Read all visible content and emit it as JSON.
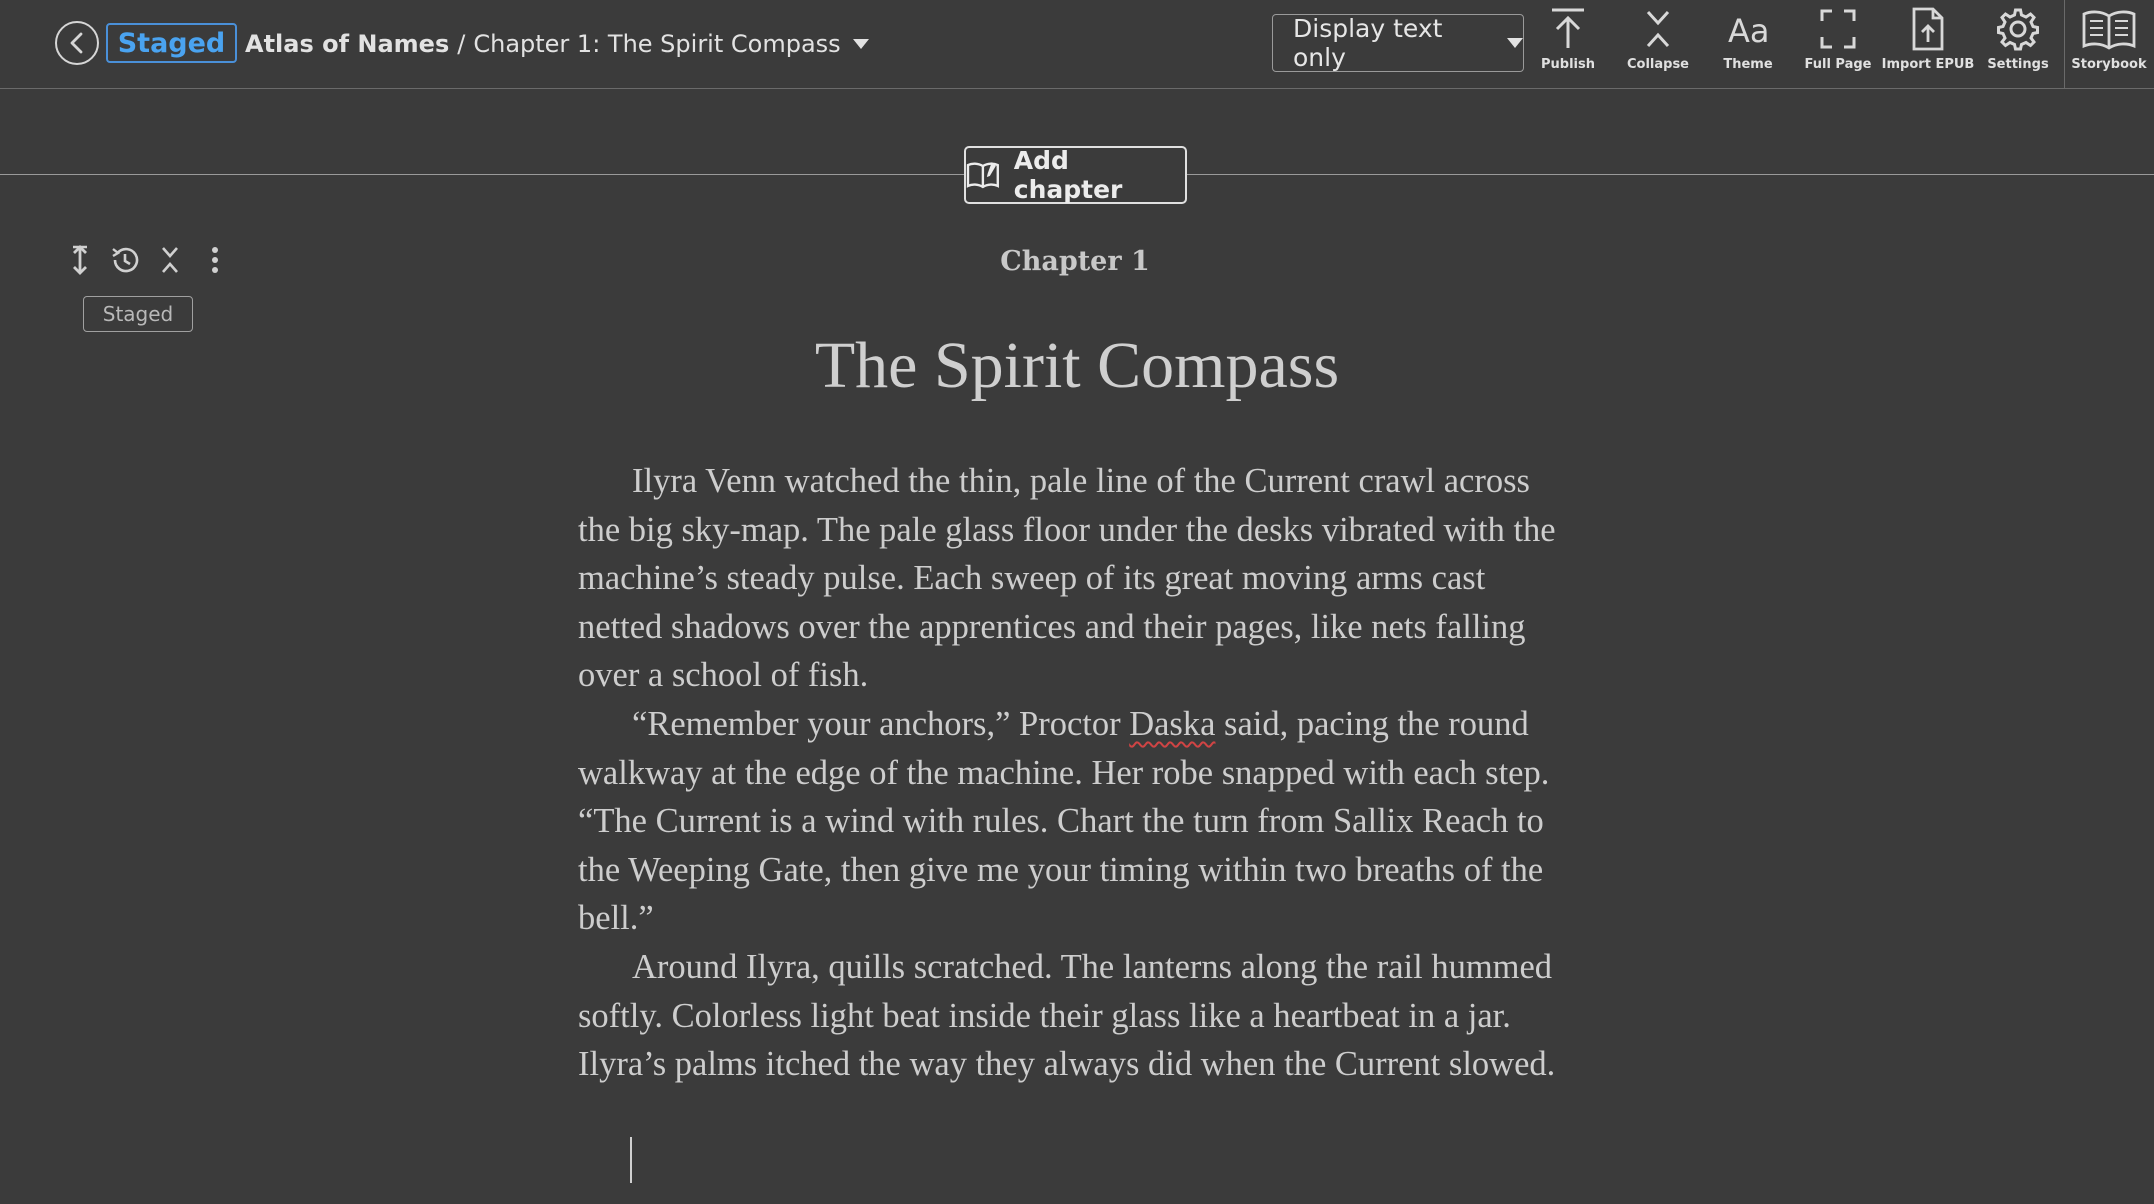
{
  "header": {
    "status_badge": "Staged",
    "book_title": "Atlas of Names",
    "separator": "/",
    "chapter_crumb": "Chapter 1: The Spirit Compass",
    "display_mode": "Display text only",
    "tools": [
      {
        "label": "Publish",
        "icon": "upload-arrow-icon"
      },
      {
        "label": "Collapse",
        "icon": "collapse-icon"
      },
      {
        "label": "Theme",
        "icon": "font-aa-icon"
      },
      {
        "label": "Full Page",
        "icon": "fullscreen-icon"
      },
      {
        "label": "Import EPUB",
        "icon": "file-upload-icon"
      },
      {
        "label": "Settings",
        "icon": "gear-icon"
      },
      {
        "label": "Storybook",
        "icon": "open-book-icon"
      }
    ]
  },
  "add_chapter": {
    "label": "Add chapter",
    "icon": "book-pen-icon"
  },
  "chapter_tools": {
    "icons": [
      "move-vertical-icon",
      "history-icon",
      "collapse-small-icon",
      "more-vertical-icon"
    ],
    "status": "Staged"
  },
  "chapter": {
    "number_label": "Chapter 1",
    "title": "The Spirit Compass",
    "paragraphs": [
      "Ilyra Venn watched the thin, pale line of the Current crawl across the big sky-map. The pale glass floor under the desks vibrated with the machine’s steady pulse. Each sweep of its great moving arms cast netted shadows over the apprentices and their pages, like nets falling over a school of fish.",
      "“Remember your anchors,” Proctor Daska said, pacing the round walkway at the edge of the machine. Her robe snapped with each step. “The Current is a wind with rules. Chart the turn from Sallix Reach to the Weeping Gate, then give me your timing within two breaths of the bell.”",
      "Around Ilyra, quills scratched. The lanterns along the rail hummed softly. Colorless light beat inside their glass like a heartbeat in a jar. Ilyra’s palms itched the way they always did when the Current slowed."
    ],
    "p2_parts": {
      "before": "“Remember your anchors,” Proctor ",
      "misspelled": "Daska",
      "after": " said, pacing the round walkway at the edge of the machine. Her robe snapped with each step. “The Current is a wind with rules. Chart the turn from Sallix Reach to the Weeping Gate, then give me your timing within two breaths of the bell.”"
    }
  },
  "colors": {
    "background": "#3b3b3b",
    "accent": "#4aa3f0",
    "spellcheck": "#d04444"
  }
}
